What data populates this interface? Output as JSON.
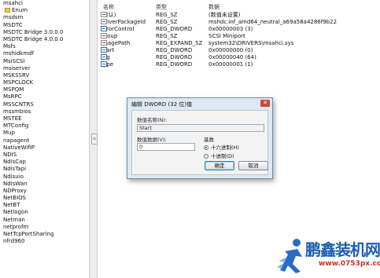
{
  "tree": {
    "items": [
      {
        "label": "msahci",
        "folder": false
      },
      {
        "label": "Enum",
        "folder": true
      },
      {
        "label": "msdsm",
        "folder": false
      },
      {
        "label": "MSDTC",
        "folder": false
      },
      {
        "label": "MSDTC Bridge 3.0.0.0",
        "folder": false
      },
      {
        "label": "MSDTC Bridge 4.0.0.0",
        "folder": false
      },
      {
        "label": "Msfs",
        "folder": false
      },
      {
        "label": "mshidkmdf",
        "folder": false
      },
      {
        "label": "MsiSCSI",
        "folder": false
      },
      {
        "label": "msiserver",
        "folder": false
      },
      {
        "label": "MSKSSRV",
        "folder": false
      },
      {
        "label": "MSPCLOCK",
        "folder": false
      },
      {
        "label": "MSPQM",
        "folder": false
      },
      {
        "label": "MsRPC",
        "folder": false
      },
      {
        "label": "MSSCNTRS",
        "folder": false
      },
      {
        "label": "mssmbios",
        "folder": false
      },
      {
        "label": "MSTEE",
        "folder": false
      },
      {
        "label": "MTConfig",
        "folder": false
      },
      {
        "label": "Mup",
        "folder": false
      },
      {
        "label": "napagent",
        "folder": false
      },
      {
        "label": "NativeWifiP",
        "folder": false
      },
      {
        "label": "NDIS",
        "folder": false
      },
      {
        "label": "NdisCap",
        "folder": false
      },
      {
        "label": "NdisTapi",
        "folder": false
      },
      {
        "label": "Ndisuio",
        "folder": false
      },
      {
        "label": "NdisWan",
        "folder": false
      },
      {
        "label": "NDProxy",
        "folder": false
      },
      {
        "label": "NetBIOS",
        "folder": false
      },
      {
        "label": "NetBT",
        "folder": false
      },
      {
        "label": "Netlogon",
        "folder": false
      },
      {
        "label": "Netman",
        "folder": false
      },
      {
        "label": "netprofm",
        "folder": false
      },
      {
        "label": "NetTcpPortSharing",
        "folder": false
      },
      {
        "label": "nfrd960",
        "folder": false
      }
    ]
  },
  "columns": {
    "name": "名称",
    "type": "类型",
    "data": "数据"
  },
  "values": [
    {
      "name": "(默认)",
      "type": "REG_SZ",
      "data": "(数值未设置)",
      "icon": "string-value-icon"
    },
    {
      "name": "DriverPackageId",
      "type": "REG_SZ",
      "data": "mshdc.inf_amd64_neutral_a69a58a4286f9b22",
      "icon": "string-value-icon"
    },
    {
      "name": "ErrorControl",
      "type": "REG_DWORD",
      "data": "0x00000003 (3)",
      "icon": "dword-value-icon"
    },
    {
      "name": "Group",
      "type": "REG_SZ",
      "data": "SCSI Miniport",
      "icon": "string-value-icon"
    },
    {
      "name": "ImagePath",
      "type": "REG_EXPAND_SZ",
      "data": "system32\\DRIVERS\\msahci.sys",
      "icon": "string-value-icon"
    },
    {
      "name": "Start",
      "type": "REG_DWORD",
      "data": "0x00000000 (0)",
      "icon": "dword-value-icon"
    },
    {
      "name": "Tag",
      "type": "REG_DWORD",
      "data": "0x00000040 (64)",
      "icon": "dword-value-icon"
    },
    {
      "name": "Type",
      "type": "REG_DWORD",
      "data": "0x00000001 (1)",
      "icon": "dword-value-icon"
    }
  ],
  "dialog": {
    "title": "编辑 DWORD (32 位)值",
    "close_glyph": "✕",
    "value_name_label": "数值名称(N):",
    "value_name": "Start",
    "value_data_label": "数值数据(V):",
    "value_data": "0",
    "base_label": "基数",
    "hex_label": "十六进制(H)",
    "dec_label": "十进制(D)",
    "ok_label": "确定",
    "cancel_label": "取消"
  },
  "splitter": {
    "grip_glyph": "≡"
  },
  "watermark": {
    "brand": "鹏鑫装机网",
    "url": "www.0753px.com"
  },
  "colors": {
    "accent": "#1d5fb0",
    "dialog_bg": "#dfe8f3",
    "watermark_red": "#c2342b"
  }
}
